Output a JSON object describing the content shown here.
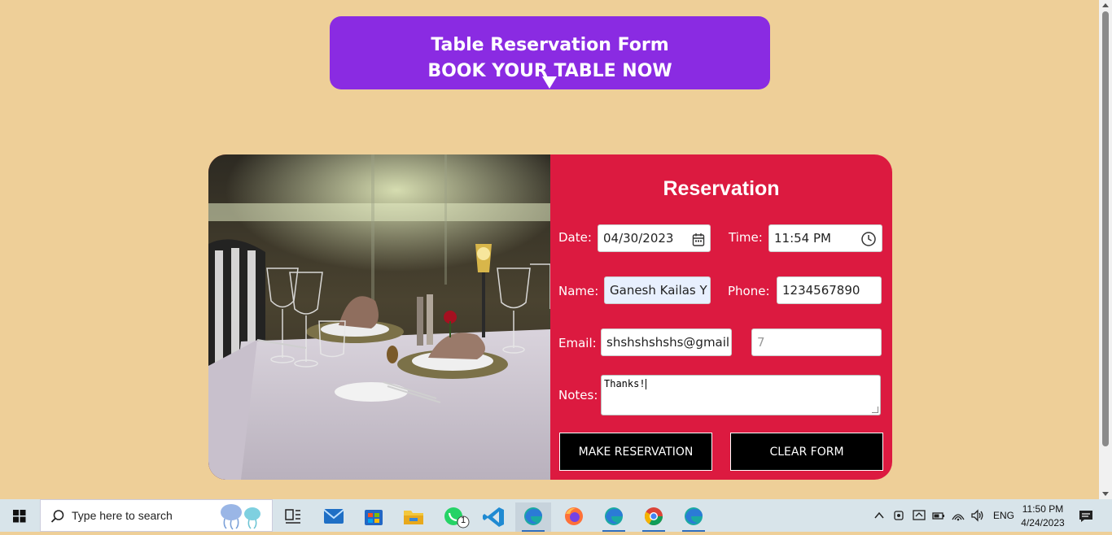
{
  "banner": {
    "title": "Table Reservation Form",
    "subtitle": "BOOK YOUR TABLE NOW"
  },
  "form": {
    "heading": "Reservation",
    "date_label": "Date:",
    "date_value": "04/30/2023",
    "time_label": "Time:",
    "time_value": "11:54 PM",
    "name_label": "Name:",
    "name_value": "Ganesh Kailas Y",
    "phone_label": "Phone:",
    "phone_value": "1234567890",
    "email_label": "Email:",
    "email_value": "shshshshshs@gmail",
    "guests_placeholder": "7",
    "notes_label": "Notes:",
    "notes_value": "Thanks!",
    "submit_label": "MAKE RESERVATION",
    "clear_label": "CLEAR FORM"
  },
  "colors": {
    "background": "#eecf98",
    "banner": "#8a2be2",
    "form_panel": "#dc1a40",
    "button": "#000000"
  },
  "taskbar": {
    "search_placeholder": "Type here to search",
    "apps": [
      "task-view-icon",
      "mail-icon",
      "store-icon",
      "file-explorer-icon",
      "whatsapp-icon",
      "vscode-icon",
      "edge-icon",
      "firefox-icon",
      "edge-icon",
      "chrome-icon",
      "edge-icon"
    ],
    "whatsapp_badge": "1",
    "language": "ENG",
    "time": "11:50 PM",
    "date": "4/24/2023"
  }
}
